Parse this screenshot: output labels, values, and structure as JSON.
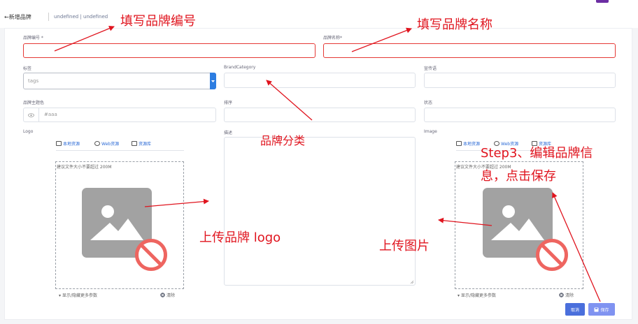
{
  "header": {
    "back_label": "←新增品牌",
    "breadcrumb": "undefined | undefined",
    "user": {
      "avatar_color": "#6c2ea3"
    }
  },
  "form": {
    "brand_code": {
      "label": "品牌编号 *",
      "value": ""
    },
    "brand_name": {
      "label": "品牌名称*",
      "value": ""
    },
    "tags": {
      "label": "标签",
      "placeholder": "tags"
    },
    "brand_category": {
      "label": "BrandCategory",
      "value": ""
    },
    "slogan": {
      "label": "宣传语",
      "value": ""
    },
    "main_color": {
      "label": "品牌主题色",
      "placeholder": "#aaa"
    },
    "sort": {
      "label": "排序",
      "value": ""
    },
    "status": {
      "label": "状态",
      "value": ""
    },
    "logo": {
      "label": "Logo"
    },
    "description": {
      "label": "描述",
      "value": ""
    },
    "image": {
      "label": "Image"
    }
  },
  "uploader": {
    "tabs": [
      "本地资源",
      "Web资源",
      "资源库"
    ],
    "hint": "建议文件大小不要超过 200M",
    "more_params": "▾ 显示/隐藏更多参数",
    "clear": "清除"
  },
  "actions": {
    "cancel": "取消",
    "save": "保存"
  },
  "annotations": {
    "fill_code": "填写品牌编号",
    "fill_name": "填写品牌名称",
    "category": "品牌分类",
    "upload_logo": "上传品牌 logo",
    "upload_image": "上传图片",
    "step3_line1": "Step3、编辑品牌信",
    "step3_line2": "息，点击保存"
  },
  "colors": {
    "annotation": "#e0141e",
    "error_border": "#e53935",
    "cancel_button": "#4a6fdc",
    "save_button": "#8093f1",
    "select_arrow": "#2d7de1"
  }
}
